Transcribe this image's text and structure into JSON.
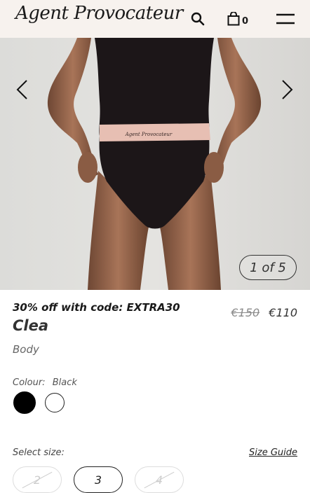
{
  "header": {
    "logo": "Agent Provocateur",
    "bag_count": "0"
  },
  "hero": {
    "counter": "1 of 5",
    "waistband_text": "Agent Provocateur"
  },
  "product": {
    "promo": "30% off with code: EXTRA30",
    "old_price": "€150",
    "new_price": "€110",
    "name": "Clea",
    "category": "Body",
    "colour_label": "Colour:",
    "colour_selected": "Black",
    "swatches": [
      {
        "name": "Black",
        "color": "#000000",
        "selected": true
      },
      {
        "name": "White",
        "color": "#ffffff",
        "selected": false
      }
    ]
  },
  "sizes": {
    "label": "Select size:",
    "guide": "Size Guide",
    "options": [
      {
        "label": "2",
        "available": false
      },
      {
        "label": "3",
        "available": true,
        "selected": true
      },
      {
        "label": "4",
        "available": false
      }
    ]
  }
}
